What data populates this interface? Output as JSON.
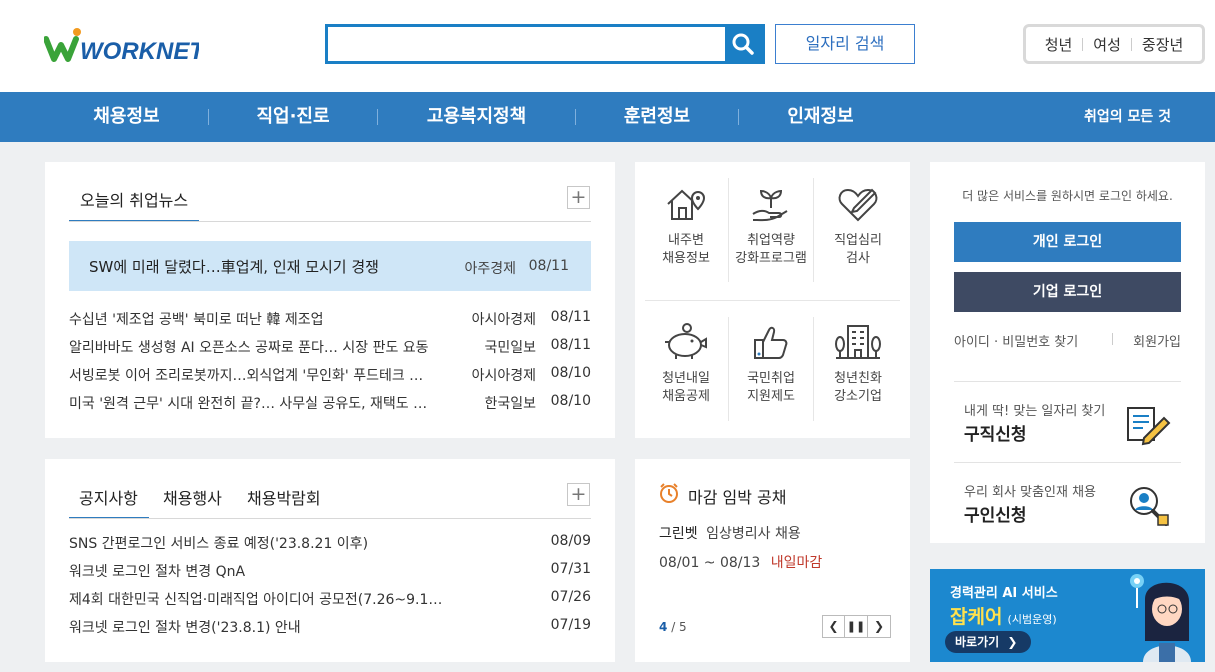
{
  "header": {
    "logo_text": "WORKNET",
    "search": {
      "value": "",
      "placeholder": ""
    },
    "job_search_button": "일자리 검색",
    "segments": [
      "청년",
      "여성",
      "중장년"
    ]
  },
  "nav": {
    "items": [
      "채용정보",
      "직업·진로",
      "고용복지정책",
      "훈련정보",
      "인재정보"
    ],
    "all_menu": "취업의 모든 것"
  },
  "news": {
    "tab": "오늘의 취업뉴스",
    "plus": "+",
    "headline": {
      "title": "SW에 미래 달렸다…車업계, 인재 모시기 경쟁",
      "source": "아주경제",
      "date": "08/11"
    },
    "items": [
      {
        "title": "수십년 '제조업 공백' 북미로 떠난 韓 제조업",
        "source": "아시아경제",
        "date": "08/11"
      },
      {
        "title": "알리바바도 생성형 AI 오픈소스 공짜로 푼다… 시장 판도 요동",
        "source": "국민일보",
        "date": "08/11"
      },
      {
        "title": "서빙로봇 이어 조리로봇까지…외식업계 '무인화' 푸드테크 …",
        "source": "아시아경제",
        "date": "08/10"
      },
      {
        "title": "미국 '원격 근무' 시대 완전히 끝?… 사무실 공유도, 재택도 …",
        "source": "한국일보",
        "date": "08/10"
      }
    ]
  },
  "services": {
    "items": [
      {
        "label1": "내주변",
        "label2": "채용정보",
        "icon": "house-location-icon"
      },
      {
        "label1": "취업역량",
        "label2": "강화프로그램",
        "icon": "sprout-hand-icon"
      },
      {
        "label1": "직업심리",
        "label2": "검사",
        "icon": "heart-pencil-icon"
      },
      {
        "label1": "청년내일",
        "label2": "채움공제",
        "icon": "piggy-bank-icon"
      },
      {
        "label1": "국민취업",
        "label2": "지원제도",
        "icon": "thumbs-up-icon"
      },
      {
        "label1": "청년친화",
        "label2": "강소기업",
        "icon": "building-icon"
      }
    ]
  },
  "login": {
    "prompt": "더 많은 서비스를 원하시면 로그인 하세요.",
    "personal_button": "개인 로그인",
    "business_button": "기업 로그인",
    "find_link": "아이디 · 비밀번호 찾기",
    "join_link": "회원가입",
    "job_apply": {
      "sub": "내게 딱! 맞는 일자리 찾기",
      "title": "구직신청"
    },
    "talent_apply": {
      "sub": "우리 회사 맞춤인재 채용",
      "title": "구인신청"
    }
  },
  "notices": {
    "tabs": [
      "공지사항",
      "채용행사",
      "채용박람회"
    ],
    "plus": "+",
    "items": [
      {
        "title": "SNS 간편로그인 서비스 종료 예정('23.8.21 이후)",
        "date": "08/09"
      },
      {
        "title": "워크넷 로그인 절차 변경 QnA",
        "date": "07/31"
      },
      {
        "title": "제4회 대한민국 신직업·미래직업 아이디어 공모전(7.26~9.1…",
        "date": "07/26"
      },
      {
        "title": "워크넷 로그인 절차 변경('23.8.1) 안내",
        "date": "07/19"
      }
    ]
  },
  "deadline": {
    "title": "마감 임박 공채",
    "company": "그린벳",
    "job": "임상병리사 채용",
    "period": "08/01 ~ 08/13",
    "badge": "내일마감",
    "page_current": "4",
    "page_total": "/ 5",
    "colors": {
      "badge": "#c0392b",
      "clock": "#e8812b"
    }
  },
  "banner": {
    "line1": "경력관리 AI 서비스",
    "line2": "잡케어",
    "line2_sub": "(시범운영)",
    "button": "바로가기"
  },
  "colors": {
    "brand_blue": "#2f7cbf",
    "dark_button": "#3e4a63",
    "logo_green": "#3aa339",
    "logo_blue": "#1a5ea8"
  }
}
